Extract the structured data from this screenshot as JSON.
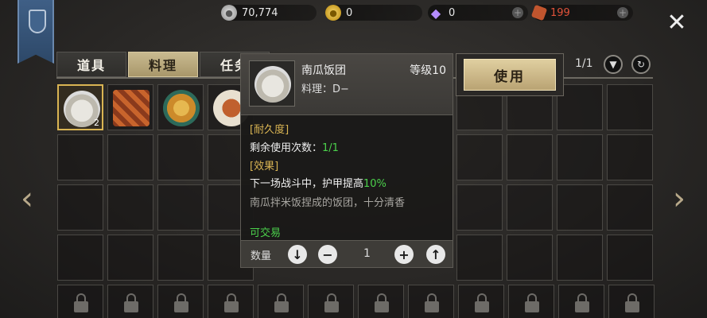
{
  "currencies": {
    "silver": "70,774",
    "gold": "0",
    "gem": "0",
    "ticket": "199"
  },
  "tabs": [
    "道具",
    "料理",
    "任务"
  ],
  "page": "1/1",
  "item_count": "2",
  "use_label": "使用",
  "tooltip": {
    "name": "南瓜饭团",
    "level": "等级10",
    "type": "料理：D−",
    "durability_header": "[耐久度]",
    "remaining_label": "剩余使用次数：",
    "remaining_value": "1/1",
    "effect_header": "[效果]",
    "effect_text": "下一场战斗中，护甲提高",
    "effect_value": "10%",
    "description": "南瓜拌米饭捏成的饭团，十分清香",
    "tradable": "可交易",
    "qty_label": "数量",
    "qty_value": "1"
  },
  "icons": [
    "banner-crest-icon",
    "silver-coin-icon",
    "gold-coin-icon",
    "diamond-icon",
    "ticket-icon",
    "close-icon",
    "lock-icon",
    "refresh-icon",
    "chevron-down-icon"
  ],
  "colors": {
    "accent_gold": "#d9b453",
    "effect_green": "#4bd14b"
  }
}
